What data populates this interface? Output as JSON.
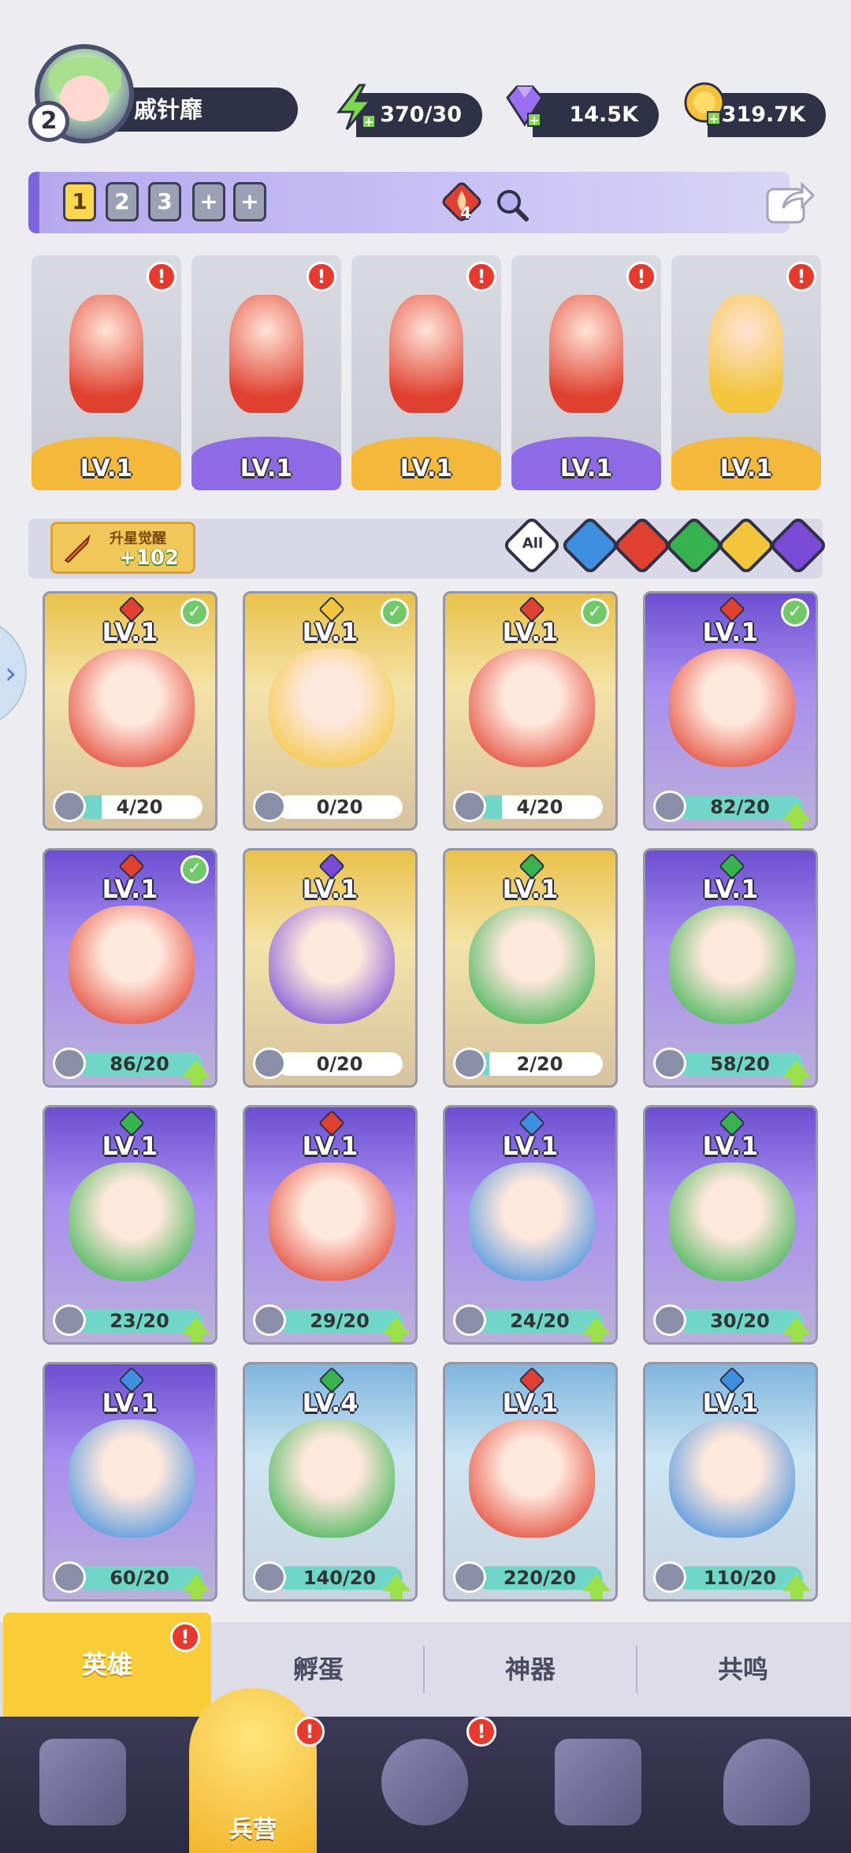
{
  "player": {
    "level": "2",
    "name": "戚针靡"
  },
  "resources": {
    "energy": "370/30",
    "gems": "14.5K",
    "coins": "319.7K"
  },
  "team_bar": {
    "tabs": [
      "1",
      "2",
      "3",
      "+",
      "+"
    ],
    "fire_count": "4"
  },
  "team": [
    {
      "level": "LV.1",
      "element": "fire",
      "base": "gold"
    },
    {
      "level": "LV.1",
      "element": "fire",
      "base": "purple"
    },
    {
      "level": "LV.1",
      "element": "fire",
      "base": "gold"
    },
    {
      "level": "LV.1",
      "element": "fire",
      "base": "purple"
    },
    {
      "level": "LV.1",
      "element": "light",
      "base": "gold"
    }
  ],
  "upstar": {
    "label": "升星觉醒",
    "value": "+102"
  },
  "filters": {
    "all_label": "All",
    "elements": [
      "water",
      "fire",
      "wind",
      "light",
      "dark"
    ]
  },
  "heroes": [
    {
      "level": "LV.1",
      "element": "fire",
      "shards": "4/20",
      "progress": 0.2,
      "rarity": "gold",
      "checked": true,
      "upgrade": false
    },
    {
      "level": "LV.1",
      "element": "light",
      "shards": "0/20",
      "progress": 0,
      "rarity": "gold",
      "checked": true,
      "upgrade": false
    },
    {
      "level": "LV.1",
      "element": "fire",
      "shards": "4/20",
      "progress": 0.2,
      "rarity": "gold",
      "checked": true,
      "upgrade": false
    },
    {
      "level": "LV.1",
      "element": "fire",
      "shards": "82/20",
      "progress": 1,
      "rarity": "purple",
      "checked": true,
      "upgrade": true
    },
    {
      "level": "LV.1",
      "element": "fire",
      "shards": "86/20",
      "progress": 1,
      "rarity": "purple",
      "checked": true,
      "upgrade": true
    },
    {
      "level": "LV.1",
      "element": "dark",
      "shards": "0/20",
      "progress": 0,
      "rarity": "gold",
      "checked": false,
      "upgrade": false
    },
    {
      "level": "LV.1",
      "element": "wind",
      "shards": "2/20",
      "progress": 0.1,
      "rarity": "gold",
      "checked": false,
      "upgrade": false
    },
    {
      "level": "LV.1",
      "element": "wind",
      "shards": "58/20",
      "progress": 1,
      "rarity": "purple",
      "checked": false,
      "upgrade": true
    },
    {
      "level": "LV.1",
      "element": "wind",
      "shards": "23/20",
      "progress": 1,
      "rarity": "purple",
      "checked": false,
      "upgrade": true
    },
    {
      "level": "LV.1",
      "element": "fire",
      "shards": "29/20",
      "progress": 1,
      "rarity": "purple",
      "checked": false,
      "upgrade": true
    },
    {
      "level": "LV.1",
      "element": "water",
      "shards": "24/20",
      "progress": 1,
      "rarity": "purple",
      "checked": false,
      "upgrade": true
    },
    {
      "level": "LV.1",
      "element": "wind",
      "shards": "30/20",
      "progress": 1,
      "rarity": "purple",
      "checked": false,
      "upgrade": true
    },
    {
      "level": "LV.1",
      "element": "water",
      "shards": "60/20",
      "progress": 1,
      "rarity": "purple",
      "checked": false,
      "upgrade": true
    },
    {
      "level": "LV.4",
      "element": "wind",
      "shards": "140/20",
      "progress": 1,
      "rarity": "blue",
      "checked": false,
      "upgrade": true
    },
    {
      "level": "LV.1",
      "element": "fire",
      "shards": "220/20",
      "progress": 1,
      "rarity": "blue",
      "checked": false,
      "upgrade": true
    },
    {
      "level": "LV.1",
      "element": "water",
      "shards": "110/20",
      "progress": 1,
      "rarity": "blue",
      "checked": false,
      "upgrade": true
    }
  ],
  "sub_tabs": [
    "英雄",
    "孵蛋",
    "神器",
    "共鸣"
  ],
  "nav": {
    "active_label": "兵营",
    "items": [
      "cards-icon",
      "barracks-icon",
      "map-icon",
      "locked-chest-icon",
      "mushroom-icon"
    ]
  },
  "badge": "!",
  "colors": {
    "fire": "#e0402f",
    "water": "#3f8fe0",
    "wind": "#36b24e",
    "light": "#f2c53a",
    "dark": "#7a4bd6",
    "gold_base": "#f4b83a",
    "purple_base": "#8f6ae6",
    "accent": "#f9cd38"
  }
}
